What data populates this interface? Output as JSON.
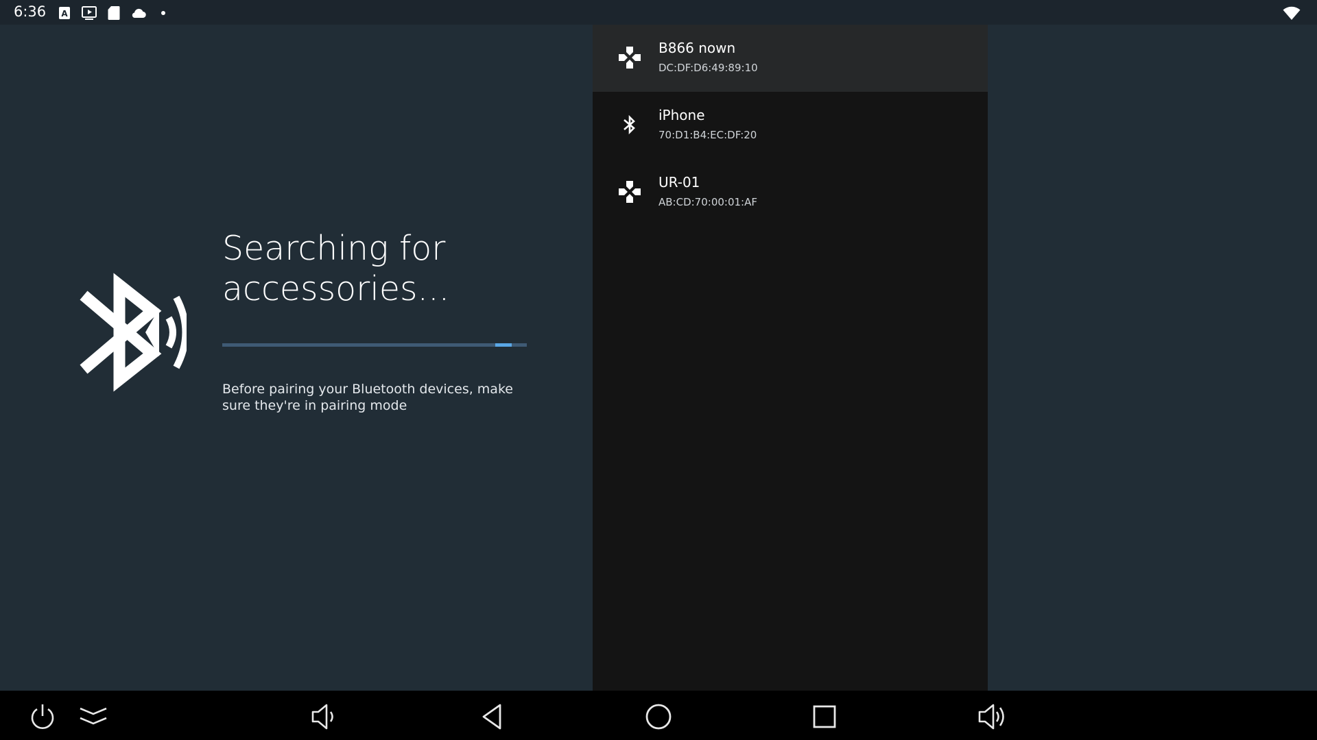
{
  "status_bar": {
    "time": "6:36",
    "notification_icons": [
      "text-a-icon",
      "media-play-icon",
      "sd-card-icon",
      "cloud-icon",
      "dot-icon"
    ],
    "wifi_icon": "wifi-icon"
  },
  "search": {
    "title": "Searching for accessories...",
    "hint": "Before pairing your Bluetooth devices, make sure they're in pairing mode",
    "progress": 0.95
  },
  "devices": [
    {
      "name": "B866 nown",
      "address": "DC:DF:D6:49:89:10",
      "icon": "gamepad-icon",
      "focused": true
    },
    {
      "name": "iPhone",
      "address": "70:D1:B4:EC:DF:20",
      "icon": "bluetooth-icon",
      "focused": false
    },
    {
      "name": "UR-01",
      "address": "AB:CD:70:00:01:AF",
      "icon": "gamepad-icon",
      "focused": false
    }
  ],
  "nav_bar": {
    "buttons": [
      "power-icon",
      "expand-icon",
      "volume-down-icon",
      "back-icon",
      "home-icon",
      "recents-icon",
      "volume-up-icon"
    ]
  },
  "colors": {
    "background": "#212d36",
    "list_background": "#141414",
    "focused_item": "#262829",
    "progress_track": "#3f5a75",
    "progress_fill": "#5aa7e6"
  }
}
